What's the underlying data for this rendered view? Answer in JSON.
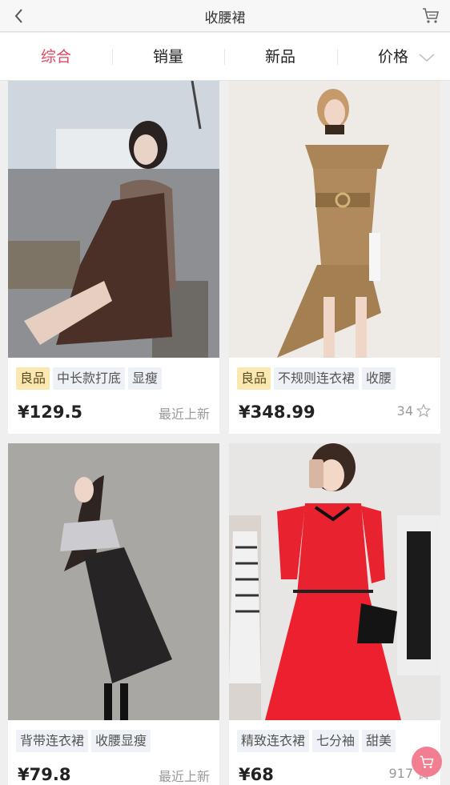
{
  "header": {
    "title": "收腰裙",
    "back_icon": "back-chevron-icon",
    "cart_icon": "shopping-cart-icon"
  },
  "tabs": [
    {
      "label": "综合",
      "active": true
    },
    {
      "label": "销量",
      "active": false
    },
    {
      "label": "新品",
      "active": false
    },
    {
      "label": "价格",
      "active": false,
      "icon": "chevron-down-icon"
    }
  ],
  "colors": {
    "accent": "#e5455e",
    "good_tag_bg": "#fbe7b0",
    "tag_bg": "#eef1f5",
    "fab": "#f2788c"
  },
  "products": [
    {
      "image": "woman-in-brown-pinafore-dress-photo",
      "tags": [
        "良品",
        "中长款打底",
        "显瘦"
      ],
      "good": true,
      "price": "¥129.5",
      "meta": "最近上新",
      "star": false
    },
    {
      "image": "model-in-khaki-off-shoulder-dress-photo",
      "tags": [
        "良品",
        "不规则连衣裙",
        "收腰"
      ],
      "good": true,
      "price": "¥348.99",
      "meta": "34",
      "star": true
    },
    {
      "image": "woman-in-black-suspender-dress-photo",
      "tags": [
        "背带连衣裙",
        "收腰显瘦"
      ],
      "good": false,
      "price": "¥79.8",
      "meta": "最近上新",
      "star": false
    },
    {
      "image": "woman-in-red-knit-dress-photo",
      "tags": [
        "精致连衣裙",
        "七分袖",
        "甜美"
      ],
      "good": false,
      "price": "¥68",
      "meta": "917",
      "star": true
    }
  ]
}
